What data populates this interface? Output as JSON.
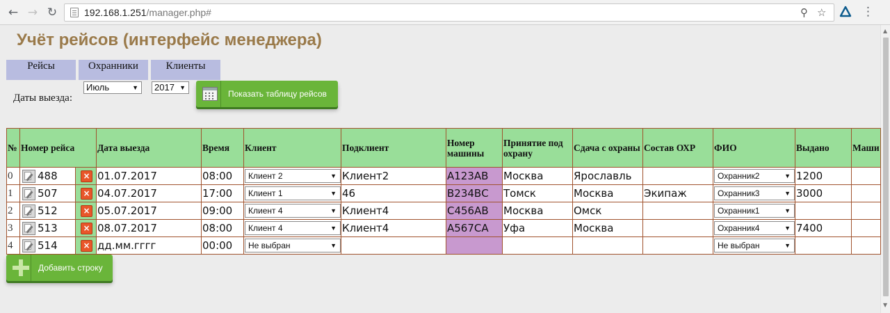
{
  "browser": {
    "url_host": "192.168.1.251",
    "url_path": "/manager.php#"
  },
  "page": {
    "title": "Учёт рейсов (интерфейс менеджера)",
    "tabs": [
      "Рейсы",
      "Охранники",
      "Клиенты"
    ],
    "dates_label": "Даты выезда:",
    "month_value": "Июль",
    "year_value": "2017",
    "show_button": "Показать таблицу рейсов",
    "add_button": "Добавить строку"
  },
  "table": {
    "headers": {
      "idx": "№",
      "number": "Номер рейса",
      "date": "Дата выезда",
      "time": "Время",
      "client": "Клиент",
      "subclient": "Подклиент",
      "car": "Номер машины",
      "accept": "Принятие под охрану",
      "deliver": "Сдача с охраны",
      "crew": "Состав ОХР",
      "fio": "ФИО",
      "issued": "Выдано",
      "cars_trunc": "Маши"
    },
    "rows": [
      {
        "idx": "0",
        "number": "488",
        "date": "01.07.2017",
        "time": "08:00",
        "client": "Клиент 2",
        "subclient": "Клиент2",
        "car": "А123АВ",
        "accept": "Москва",
        "deliver": "Ярославль",
        "crew": "",
        "fio": "Охранник2",
        "issued": "1200"
      },
      {
        "idx": "1",
        "number": "507",
        "date": "04.07.2017",
        "time": "17:00",
        "client": "Клиент 1",
        "subclient": "46",
        "car": "В234ВС",
        "accept": "Томск",
        "deliver": "Москва",
        "crew": "Экипаж",
        "fio": "Охранник3",
        "issued": "3000"
      },
      {
        "idx": "2",
        "number": "512",
        "date": "05.07.2017",
        "time": "09:00",
        "client": "Клиент 4",
        "subclient": "Клиент4",
        "car": "С456АВ",
        "accept": "Москва",
        "deliver": "Омск",
        "crew": "",
        "fio": "Охранник1",
        "issued": ""
      },
      {
        "idx": "3",
        "number": "513",
        "date": "08.07.2017",
        "time": "08:00",
        "client": "Клиент 4",
        "subclient": "Клиент4",
        "car": "А567СА",
        "accept": "Уфа",
        "deliver": "Москва",
        "crew": "",
        "fio": "Охранник4",
        "issued": "7400"
      },
      {
        "idx": "4",
        "number": "514",
        "date": "дд.мм.гггг",
        "time": "00:00",
        "client": "Не выбран",
        "subclient": "",
        "car": "",
        "accept": "",
        "deliver": "",
        "crew": "",
        "fio": "Не выбран",
        "issued": ""
      }
    ]
  }
}
